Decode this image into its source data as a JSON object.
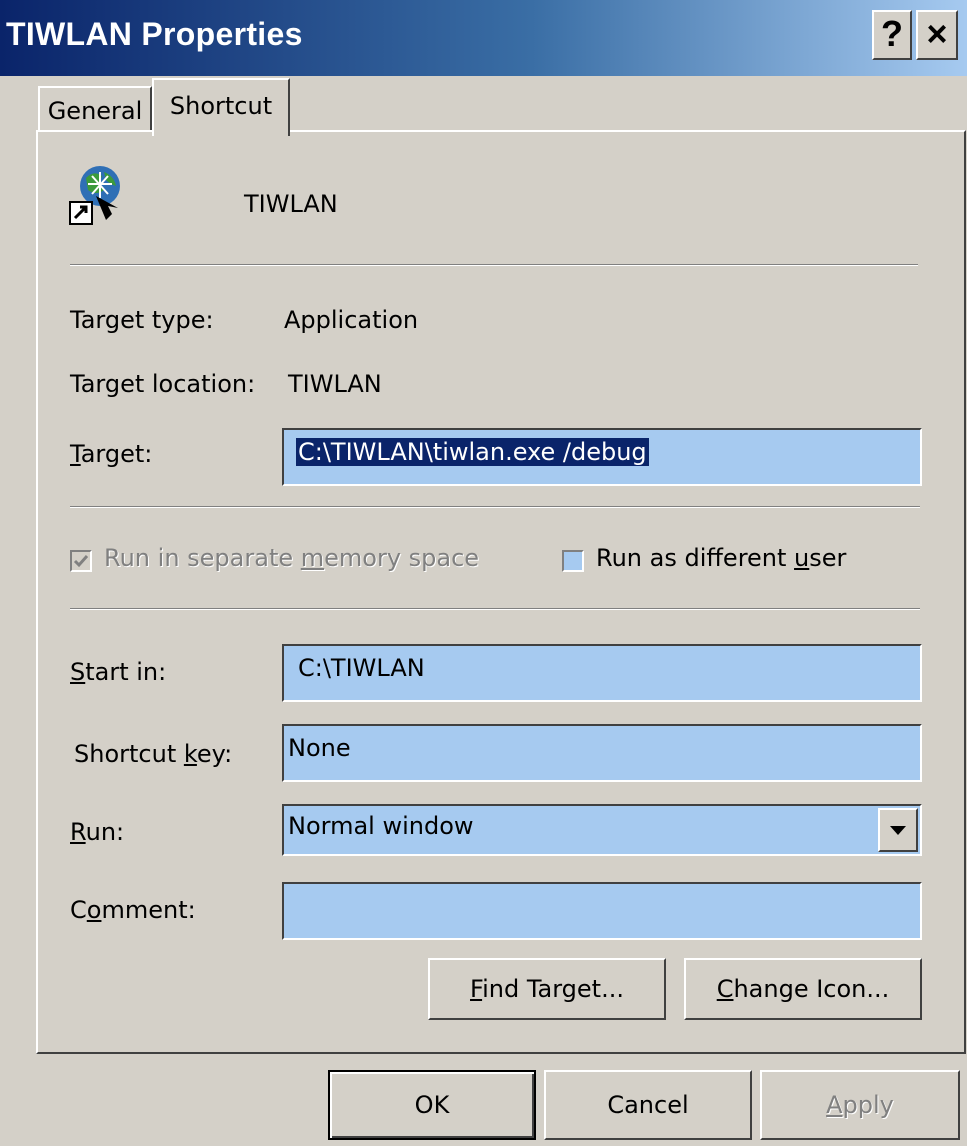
{
  "window": {
    "title": "TIWLAN Properties",
    "help_label": "?",
    "close_label": "×"
  },
  "tabs": [
    {
      "label": "General"
    },
    {
      "label": "Shortcut"
    }
  ],
  "shortcut": {
    "name": "TIWLAN",
    "target_type_label": "Target type:",
    "target_type_value": "Application",
    "target_location_label": "Target location:",
    "target_location_value": "TIWLAN",
    "target_label": "Target:",
    "target_value": "C:\\TIWLAN\\tiwlan.exe  /debug",
    "run_separate_memory": {
      "label": "Run in separate memory space",
      "checked": true,
      "enabled": false
    },
    "run_as_different_user": {
      "label": "Run as different user",
      "checked": false
    },
    "start_in_label": "Start in:",
    "start_in_value": "C:\\TIWLAN",
    "shortcut_key_label": "Shortcut key:",
    "shortcut_key_value": "None",
    "run_label": "Run:",
    "run_value": "Normal window",
    "comment_label": "Comment:",
    "comment_value": "",
    "find_target_label": "Find Target...",
    "change_icon_label": "Change Icon..."
  },
  "footer": {
    "ok_label": "OK",
    "cancel_label": "Cancel",
    "apply_label": "Apply"
  },
  "colors": {
    "face": "#d4d0c8",
    "field": "#a6caf0",
    "selection": "#0a246a"
  },
  "icons": {
    "app": "globe-shortcut-icon",
    "dropdown": "chevron-down-icon"
  }
}
